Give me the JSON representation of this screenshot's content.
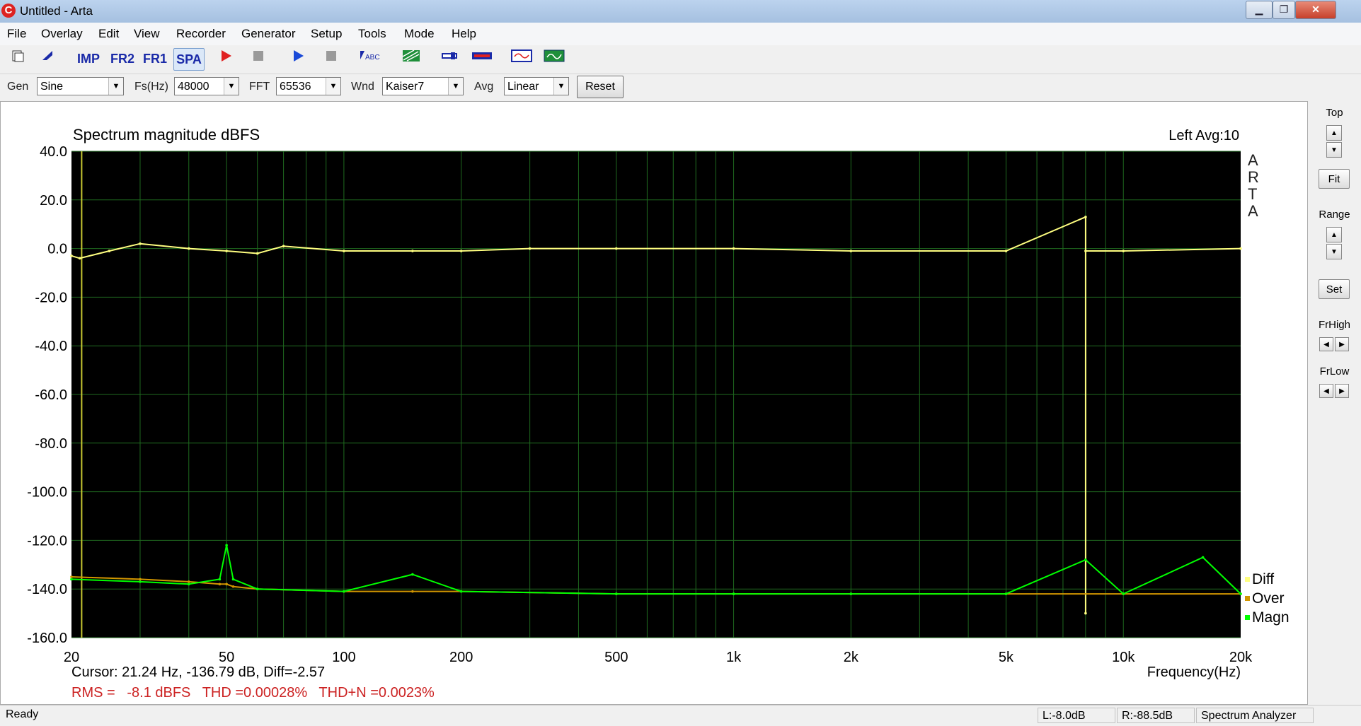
{
  "window": {
    "title": "Untitled - Arta",
    "app_icon": "C"
  },
  "window_controls": {
    "minimize": "▁",
    "maximize": "❐",
    "close": "✕"
  },
  "menu": [
    "File",
    "Overlay",
    "Edit",
    "View",
    "Recorder",
    "Generator",
    "Setup",
    "Tools",
    "Mode",
    "Help"
  ],
  "toolbar": {
    "modes": [
      {
        "label": "IMP",
        "active": false
      },
      {
        "label": "FR2",
        "active": false
      },
      {
        "label": "FR1",
        "active": false
      },
      {
        "label": "SPA",
        "active": true
      }
    ],
    "icons": [
      "new-file-icon",
      "open-icon",
      "record-icon",
      "stop-record-icon",
      "play-icon",
      "stop-play-icon",
      "abc-text-icon",
      "grid-icon",
      "probe-icon",
      "meter-icon",
      "oscilloscope-icon",
      "scope-green-icon"
    ]
  },
  "controls": {
    "gen_label": "Gen",
    "gen_value": "Sine",
    "fs_label": "Fs(Hz)",
    "fs_value": "48000",
    "fft_label": "FFT",
    "fft_value": "65536",
    "wnd_label": "Wnd",
    "wnd_value": "Kaiser7",
    "avg_label": "Avg",
    "avg_value": "Linear",
    "reset_label": "Reset"
  },
  "plot": {
    "channel_info": "Left  Avg:10",
    "brand": [
      "A",
      "R",
      "T",
      "A"
    ],
    "cursor_text": "Cursor: 21.24 Hz, -136.79 dB,  Diff=-2.57",
    "measurement_text": "RMS =   -8.1 dBFS   THD =0.00028%   THD+N =0.0023%",
    "colors": {
      "background": "#000000",
      "grid": "#1f6a1f",
      "trace_top": "#ffff80",
      "trace_magn": "#00ff00",
      "trace_over": "#d29600",
      "cursor": "#c8c832",
      "measure_text": "#cc2222"
    }
  },
  "chart_data": {
    "type": "line",
    "title": "Spectrum magnitude dBFS",
    "xlabel": "Frequency(Hz)",
    "ylabel": "",
    "x_scale": "log",
    "xlim": [
      20,
      20000
    ],
    "ylim": [
      -160,
      40
    ],
    "x_ticks": [
      20,
      50,
      100,
      200,
      500,
      1000,
      2000,
      5000,
      10000,
      20000
    ],
    "x_tick_labels": [
      "20",
      "50",
      "100",
      "200",
      "500",
      "1k",
      "2k",
      "5k",
      "10k",
      "20k"
    ],
    "y_ticks": [
      40,
      20,
      0,
      -20,
      -40,
      -60,
      -80,
      -100,
      -120,
      -140,
      -160
    ],
    "y_tick_labels": [
      "40.0",
      "20.0",
      "0.0",
      "-20.0",
      "-40.0",
      "-60.0",
      "-80.0",
      "-100.0",
      "-120.0",
      "-140.0",
      "-160.0"
    ],
    "grid": true,
    "legend_position": "bottom-right",
    "legend": [
      {
        "name": "Diff",
        "color": "#ffff80"
      },
      {
        "name": "Over",
        "color": "#d29600"
      },
      {
        "name": "Magn",
        "color": "#00ff00"
      }
    ],
    "cursor_x": 21.24,
    "series": [
      {
        "name": "",
        "color": "#ffff80",
        "x": [
          20,
          21,
          25,
          30,
          40,
          50,
          60,
          70,
          100,
          150,
          200,
          300,
          500,
          1000,
          2000,
          5000,
          8000,
          8000,
          8000,
          10000,
          20000
        ],
        "y": [
          -3,
          -4,
          -1,
          2,
          0,
          -1,
          -2,
          1,
          -1,
          -1,
          -1,
          0,
          0,
          0,
          -1,
          -1,
          13,
          -150,
          -1,
          -1,
          0
        ]
      },
      {
        "name": "Over",
        "color": "#d29600",
        "x": [
          20,
          30,
          40,
          48,
          50,
          52,
          60,
          100,
          150,
          200,
          500,
          1000,
          2000,
          5000,
          10000,
          20000
        ],
        "y": [
          -135,
          -136,
          -137,
          -138,
          -138,
          -139,
          -140,
          -141,
          -141,
          -141,
          -142,
          -142,
          -142,
          -142,
          -142,
          -142
        ]
      },
      {
        "name": "Magn",
        "color": "#00ff00",
        "x": [
          20,
          30,
          40,
          48,
          50,
          52,
          60,
          100,
          150,
          200,
          500,
          1000,
          2000,
          5000,
          8000,
          10000,
          16000,
          20000
        ],
        "y": [
          -136,
          -137,
          -138,
          -136,
          -122,
          -136,
          -140,
          -141,
          -134,
          -141,
          -142,
          -142,
          -142,
          -142,
          -128,
          -142,
          -127,
          -142
        ]
      }
    ]
  },
  "side": {
    "top_label": "Top",
    "fit_label": "Fit",
    "range_label": "Range",
    "set_label": "Set",
    "frhigh_label": "FrHigh",
    "frlow_label": "FrLow",
    "up": "▲",
    "down": "▼",
    "left": "◀",
    "right": "▶"
  },
  "status": {
    "ready": "Ready",
    "left_level": "L:-8.0dB",
    "right_level": "R:-88.5dB",
    "mode": "Spectrum Analyzer"
  }
}
